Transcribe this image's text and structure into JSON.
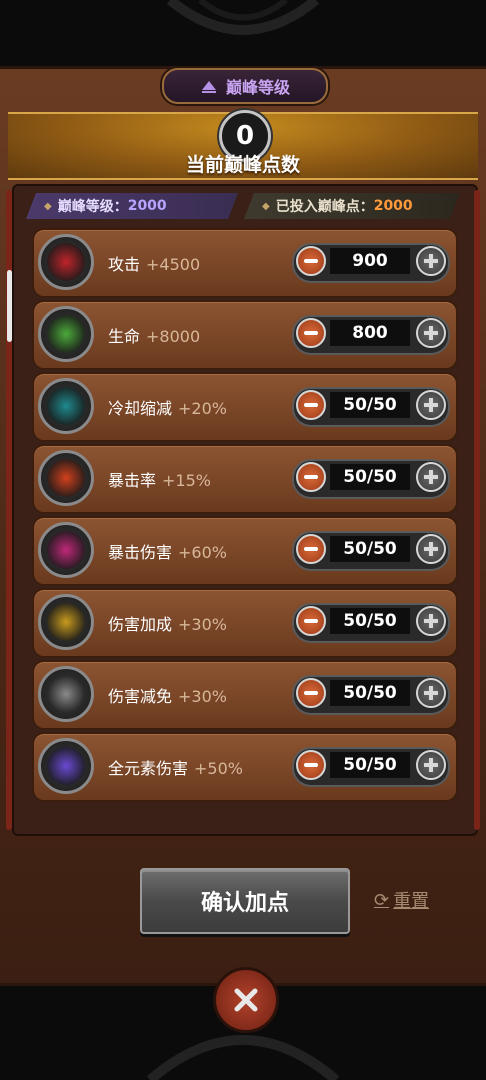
{
  "header": {
    "title": "巅峰等级"
  },
  "points": {
    "value": "0",
    "label": "当前巅峰点数"
  },
  "info": {
    "level_label": "巅峰等级：",
    "level_value": "2000",
    "spent_label": "已投入巅峰点：",
    "spent_value": "2000"
  },
  "stats": [
    {
      "name": "攻击",
      "bonus": "+4500",
      "value": "900",
      "icon": "target-icon",
      "color": "#c0242a"
    },
    {
      "name": "生命",
      "bonus": "+8000",
      "value": "800",
      "icon": "heart-cross-icon",
      "color": "#4caa3a"
    },
    {
      "name": "冷却缩减",
      "bonus": "+20%",
      "value": "50/50",
      "icon": "sword-cooldown-icon",
      "color": "#1e8a8e"
    },
    {
      "name": "暴击率",
      "bonus": "+15%",
      "value": "50/50",
      "icon": "flame-claw-icon",
      "color": "#d2401c"
    },
    {
      "name": "暴击伤害",
      "bonus": "+60%",
      "value": "50/50",
      "icon": "arrows-burst-icon",
      "color": "#c0287a"
    },
    {
      "name": "伤害加成",
      "bonus": "+30%",
      "value": "50/50",
      "icon": "lightning-icon",
      "color": "#c89a1e"
    },
    {
      "name": "伤害减免",
      "bonus": "+30%",
      "value": "50/50",
      "icon": "shield-icon",
      "color": "#8a8a8a"
    },
    {
      "name": "全元素伤害",
      "bonus": "+50%",
      "value": "50/50",
      "icon": "triple-orb-icon",
      "color": "#6a4ad2"
    }
  ],
  "actions": {
    "confirm": "确认加点",
    "reset": "重置"
  }
}
